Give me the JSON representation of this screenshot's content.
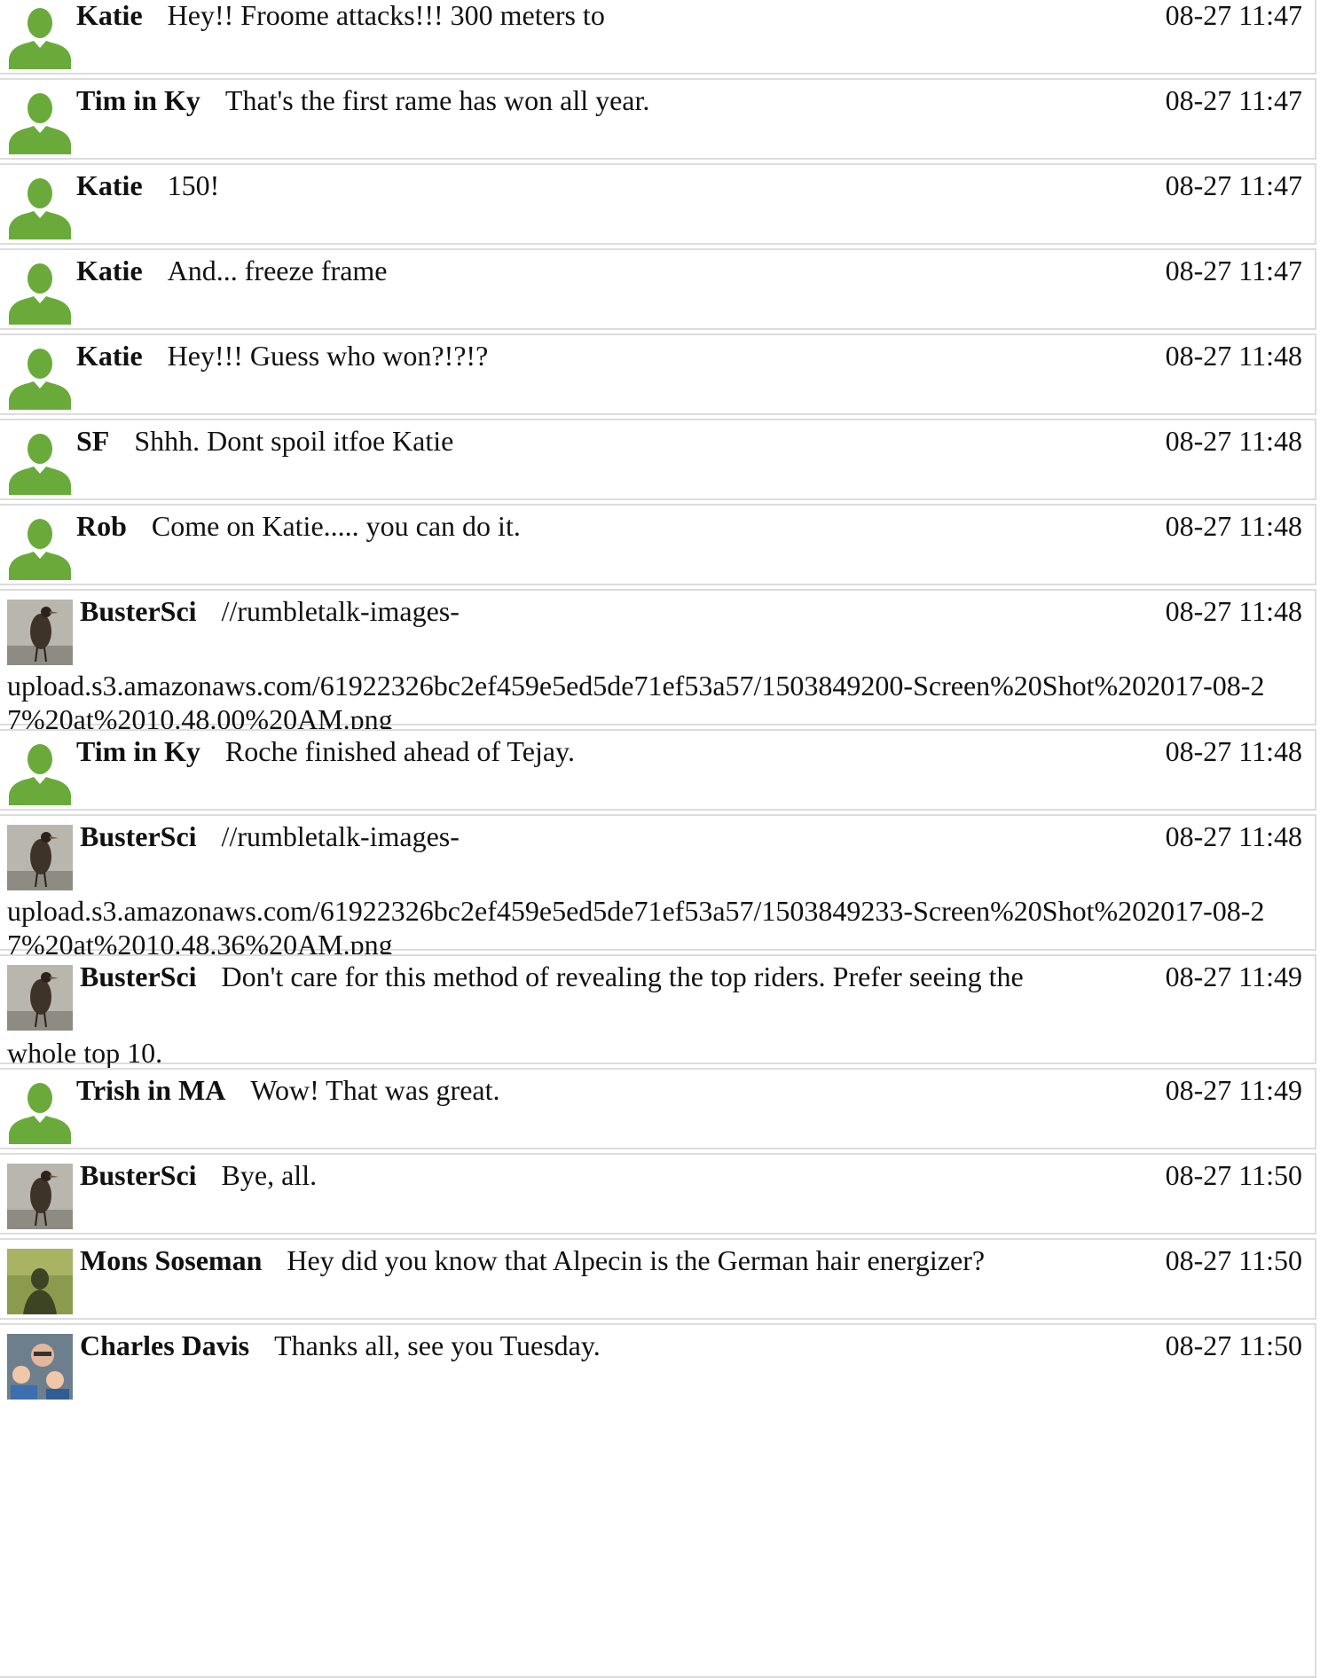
{
  "messages": [
    {
      "user": "Katie",
      "avatar": "default-user-icon",
      "text": "Hey!! Froome attacks!!! 300 meters to",
      "time": "08-27 11:47"
    },
    {
      "user": "Tim in Ky",
      "avatar": "default-user-icon",
      "text": "That's the first rame has won all year.",
      "time": "08-27 11:47"
    },
    {
      "user": "Katie",
      "avatar": "default-user-icon",
      "text": "150!",
      "time": "08-27 11:47"
    },
    {
      "user": "Katie",
      "avatar": "default-user-icon",
      "text": "And... freeze frame",
      "time": "08-27 11:47"
    },
    {
      "user": "Katie",
      "avatar": "default-user-icon",
      "text": "Hey!!! Guess who won?!?!?",
      "time": "08-27 11:48"
    },
    {
      "user": "SF",
      "avatar": "default-user-icon",
      "text": "Shhh. Dont spoil itfoe Katie",
      "time": "08-27 11:48"
    },
    {
      "user": "Rob",
      "avatar": "default-user-icon",
      "text": "Come on Katie..... you can do it.",
      "time": "08-27 11:48"
    },
    {
      "user": "BusterSci",
      "avatar": "bird-photo-avatar",
      "text": "//rumbletalk-images-",
      "continuation": "upload.s3.amazonaws.com/61922326bc2ef459e5ed5de71ef53a57/1503849200-Screen%20Shot%202017-08-27%20at%2010.48.00%20AM.png",
      "time": "08-27 11:48"
    },
    {
      "user": "Tim in Ky",
      "avatar": "default-user-icon",
      "text": "Roche finished ahead of Tejay.",
      "time": "08-27 11:48"
    },
    {
      "user": "BusterSci",
      "avatar": "bird-photo-avatar",
      "text": "//rumbletalk-images-",
      "continuation": "upload.s3.amazonaws.com/61922326bc2ef459e5ed5de71ef53a57/1503849233-Screen%20Shot%202017-08-27%20at%2010.48.36%20AM.png",
      "time": "08-27 11:48"
    },
    {
      "user": "BusterSci",
      "avatar": "bird-photo-avatar",
      "text": "Don't care for this method of revealing the top riders. Prefer seeing the",
      "continuation": "whole top 10.",
      "time": "08-27 11:49"
    },
    {
      "user": "Trish in MA",
      "avatar": "default-user-icon",
      "text": "Wow! That was great.",
      "time": "08-27 11:49"
    },
    {
      "user": "BusterSci",
      "avatar": "bird-photo-avatar",
      "text": "Bye, all.",
      "time": "08-27 11:50"
    },
    {
      "user": "Mons Soseman",
      "avatar": "shadow-photo-avatar",
      "text": "Hey did you know that Alpecin is the German hair energizer?",
      "time": "08-27 11:50"
    },
    {
      "user": "Charles Davis",
      "avatar": "family-photo-avatar",
      "text": "Thanks all, see you Tuesday.",
      "time": "08-27 11:50"
    }
  ],
  "colors": {
    "default_avatar": "#6aaa3a",
    "border": "#dcdcdc",
    "text": "#111111"
  }
}
